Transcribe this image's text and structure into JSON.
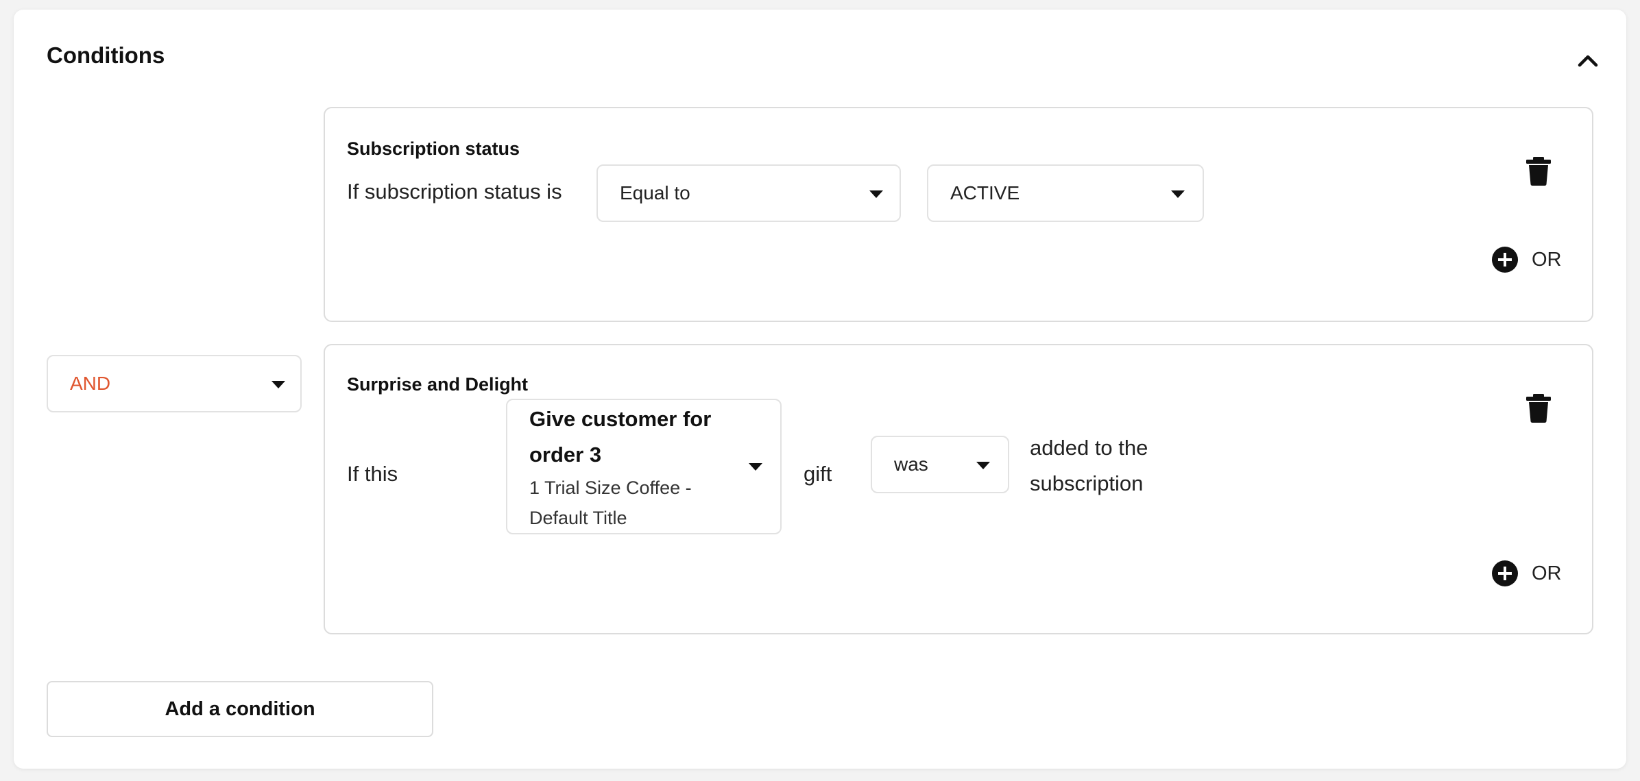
{
  "section": {
    "title": "Conditions",
    "collapse_icon": "chevron-up-icon"
  },
  "operator": {
    "value": "AND",
    "color": "#e0562f"
  },
  "conditions": [
    {
      "title": "Subscription status",
      "lead_text": "If subscription status is",
      "comparator": "Equal to",
      "value": "ACTIVE",
      "or_label": "OR"
    },
    {
      "title": "Surprise and Delight",
      "lead_text": "If this",
      "gift_title_line1": "Give customer for",
      "gift_title_line2": "order 3",
      "gift_subtitle_line1": "1 Trial Size Coffee -",
      "gift_subtitle_line2": "Default Title",
      "gift_word": "gift",
      "comparator": "was",
      "trailing_line1": "added to the",
      "trailing_line2": "subscription",
      "or_label": "OR"
    }
  ],
  "add_button": {
    "label": "Add a condition"
  },
  "icons": {
    "delete": "trash-icon",
    "add": "plus-circle-icon",
    "dropdown": "caret-down-icon"
  }
}
